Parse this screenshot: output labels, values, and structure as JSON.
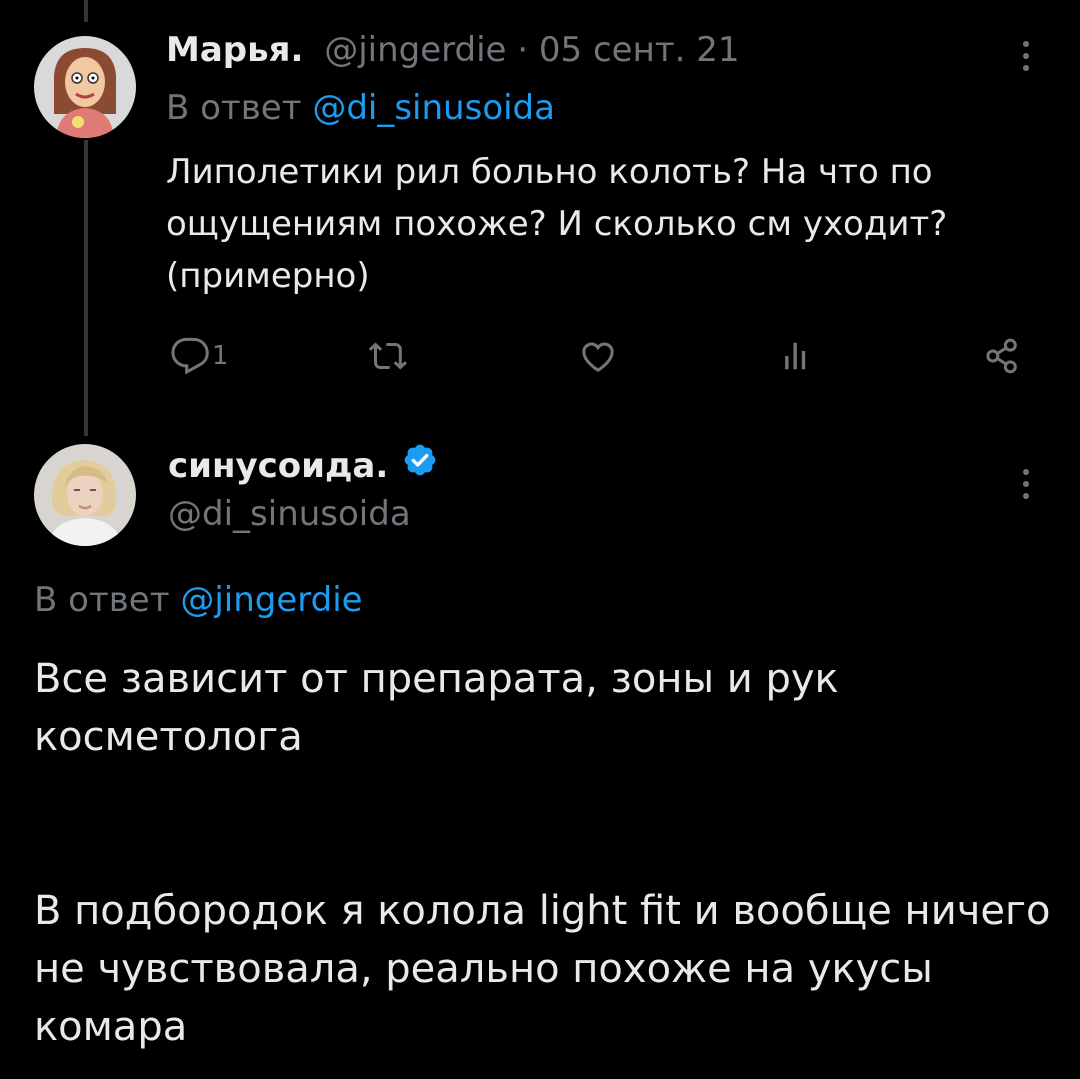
{
  "reply": {
    "name": "Марья.",
    "handle": "@jingerdie",
    "separator": " · ",
    "date": "05 сент. 21",
    "reply_to_label": "В ответ ",
    "reply_to_handle": "@di_sinusoida",
    "text": "Липолетики рил больно колоть? На что по ощущениям похоже? И сколько см уходит? (примерно)",
    "actions": {
      "reply_icon": "speech-bubble-icon",
      "reply_count": "1",
      "retweet_icon": "retweet-icon",
      "like_icon": "heart-icon",
      "views_icon": "bar-chart-icon",
      "share_icon": "share-icon"
    }
  },
  "main_tweet": {
    "name": "синусоида.",
    "verified": true,
    "handle": "@di_sinusoida",
    "reply_to_label": "В ответ ",
    "reply_to_handle": "@jingerdie",
    "text": "Все зависит от препарата, зоны и рук косметолога\n\n\nВ подбородок я колола light fit и вообще ничего не чувствовала, реально похоже на укусы комара"
  },
  "colors": {
    "background": "#000000",
    "text": "#e7e9ea",
    "muted": "#71767b",
    "link": "#1d9bf0",
    "verified": "#1d9bf0",
    "thread_line": "#333639"
  }
}
